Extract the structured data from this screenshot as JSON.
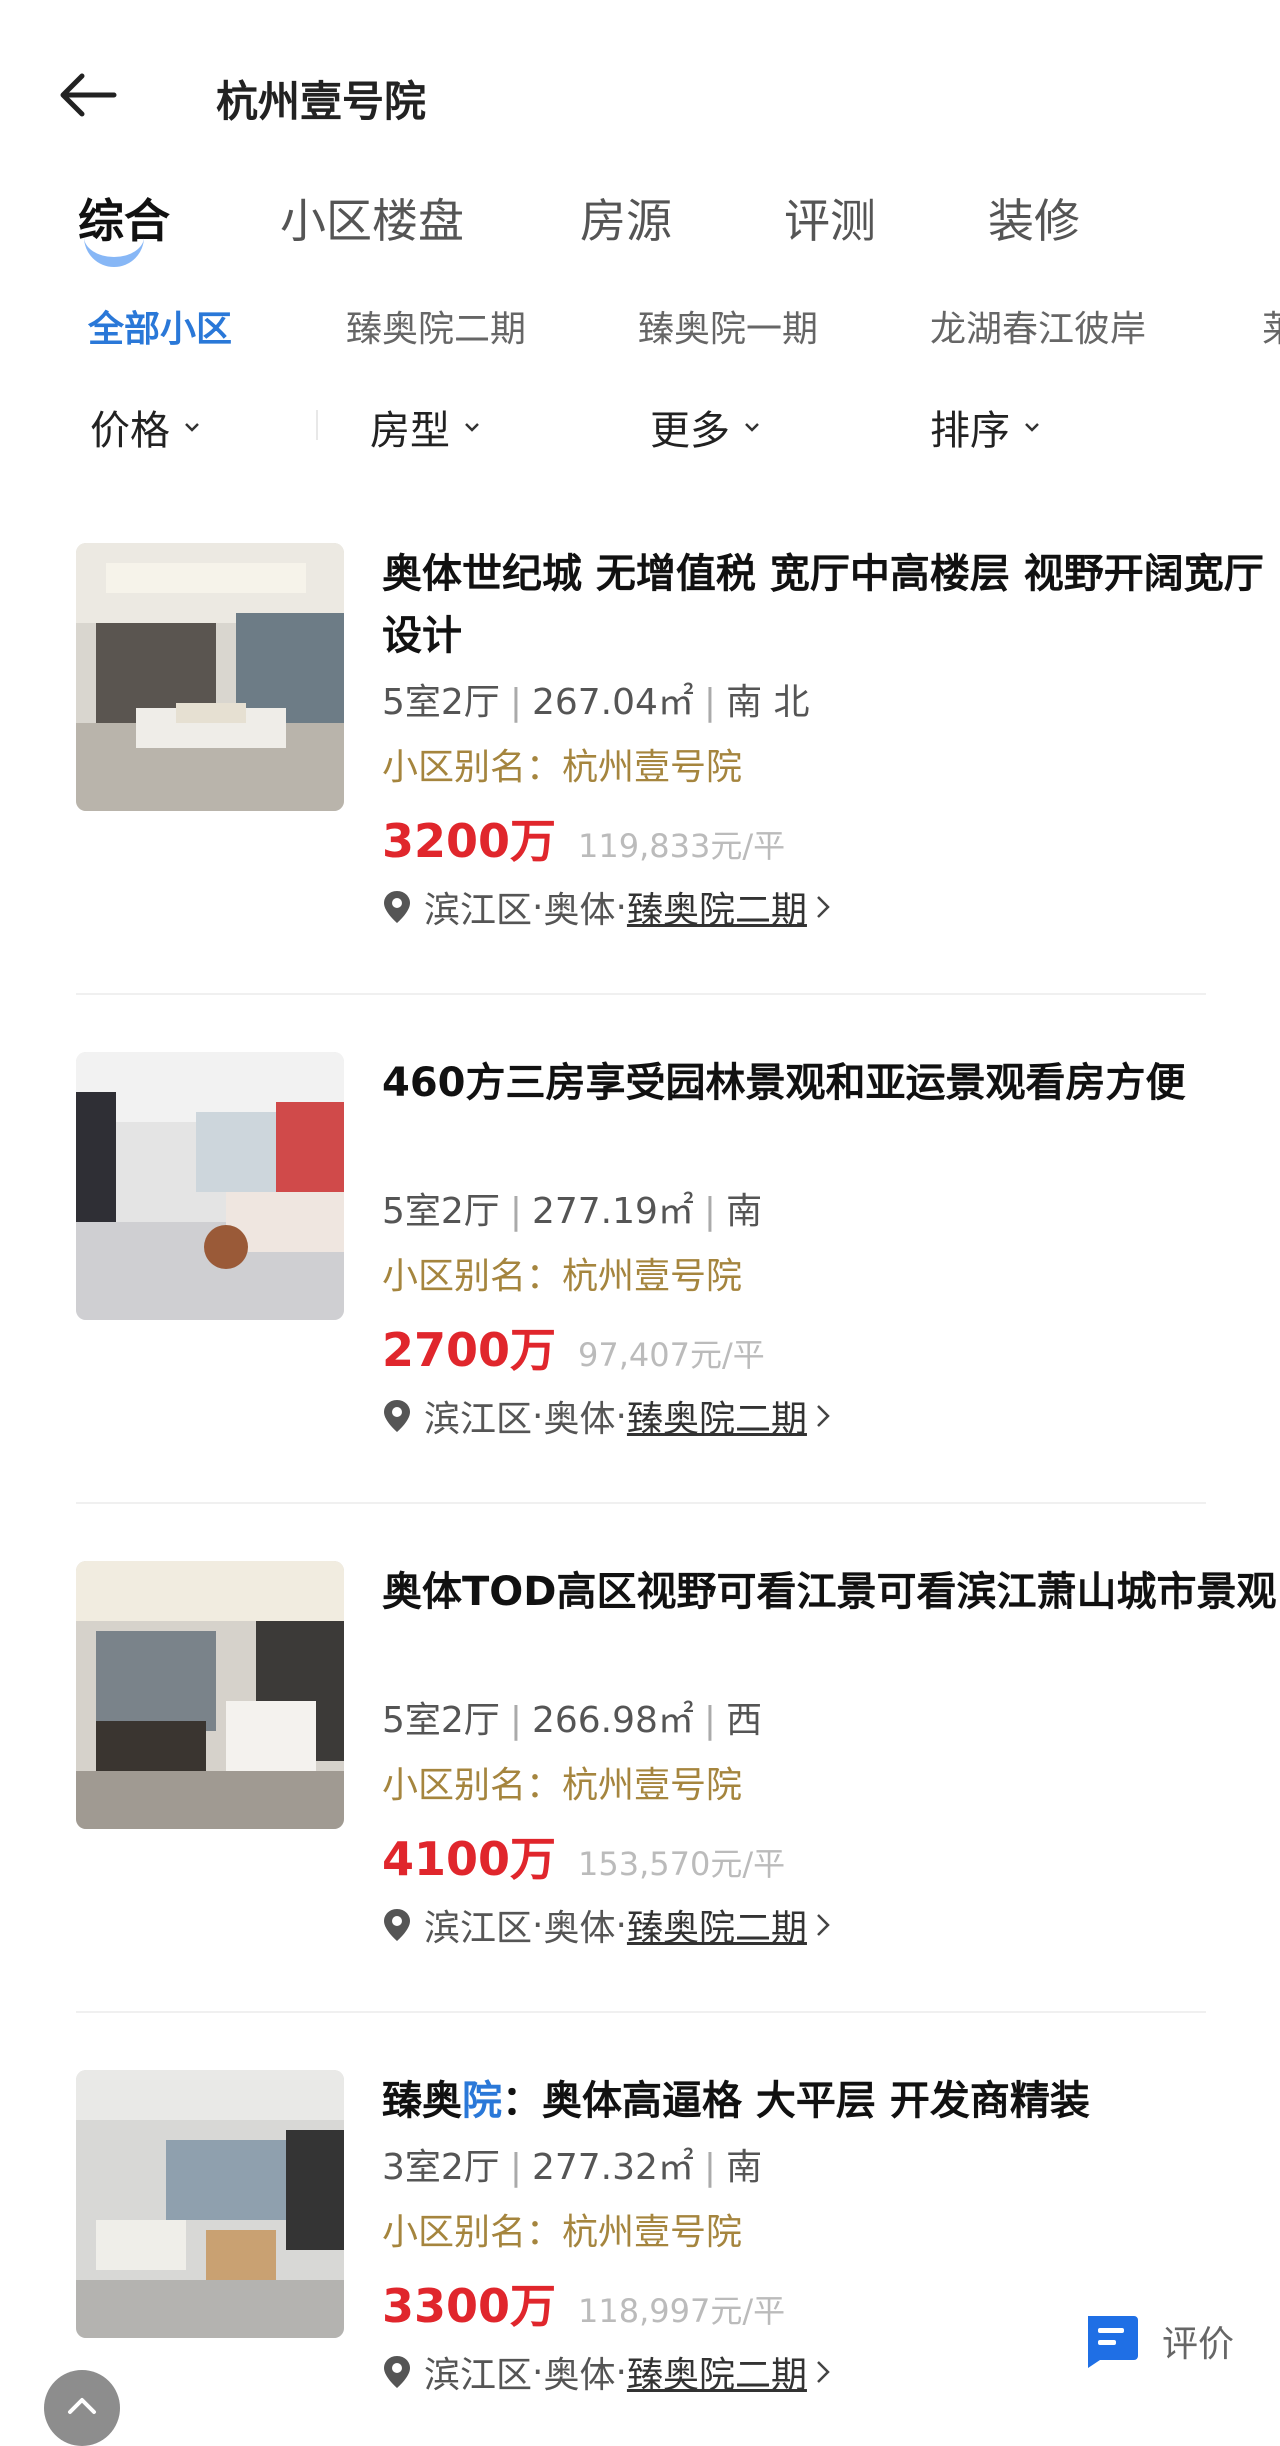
{
  "header": {
    "title": "杭州壹号院"
  },
  "main_tabs": [
    "综合",
    "小区楼盘",
    "房源",
    "评测",
    "装修"
  ],
  "community_tabs": [
    "全部小区",
    "臻奥院二期",
    "臻奥院一期",
    "龙湖春江彼岸",
    "莱"
  ],
  "filters": [
    "价格",
    "房型",
    "更多",
    "排序"
  ],
  "listings": [
    {
      "title": "奥体世纪城  无增值税 宽厅中高楼层 视野开阔宽厅设计",
      "rooms": "5室2厅",
      "area": "267.04㎡",
      "orientation": "南 北",
      "alias": "小区别名：杭州壹号院",
      "price": "3200万",
      "unit_price": "119,833元/平",
      "district": "滨江区",
      "area_name": "奥体",
      "community": "臻奥院二期"
    },
    {
      "title": "460方三房享受园林景观和亚运景观看房方便",
      "rooms": "5室2厅",
      "area": "277.19㎡",
      "orientation": "南",
      "alias": "小区别名：杭州壹号院",
      "price": "2700万",
      "unit_price": "97,407元/平",
      "district": "滨江区",
      "area_name": "奥体",
      "community": "臻奥院二期"
    },
    {
      "title": "奥体TOD高区视野可看江景可看滨江萧山城市景观",
      "rooms": "5室2厅",
      "area": "266.98㎡",
      "orientation": "西",
      "alias": "小区别名：杭州壹号院",
      "price": "4100万",
      "unit_price": "153,570元/平",
      "district": "滨江区",
      "area_name": "奥体",
      "community": "臻奥院二期"
    },
    {
      "title_prefix": "臻奥",
      "title_highlight": "院",
      "title_suffix": "：奥体高逼格 大平层 开发商精装",
      "rooms": "3室2厅",
      "area": "277.32㎡",
      "orientation": "南",
      "alias": "小区别名：杭州壹号院",
      "price": "3300万",
      "unit_price": "118,997元/平",
      "district": "滨江区",
      "area_name": "奥体",
      "community": "臻奥院二期"
    }
  ],
  "review_button": {
    "label": "评价"
  },
  "icons": [
    "back-arrow-icon",
    "chevron-down-icon",
    "location-pin-icon",
    "chevron-right-icon",
    "chat-icon",
    "arrow-up-icon"
  ],
  "colors": {
    "accent": "#2a78d8",
    "price": "#e0262c",
    "alias": "#a5853e"
  }
}
